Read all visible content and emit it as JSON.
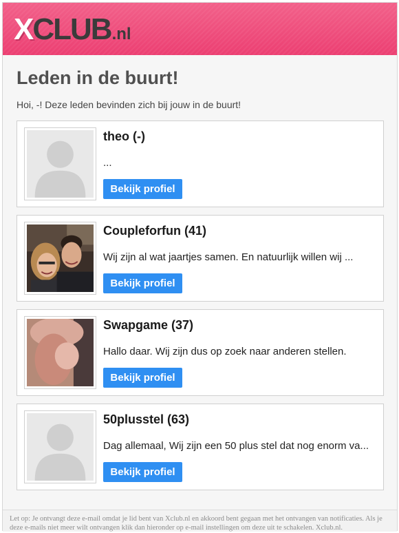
{
  "header": {
    "logo_x": "X",
    "logo_club": "CLUB",
    "logo_tld": ".nl",
    "colors": {
      "brand": "#ee4a79",
      "logo_dark": "#3b3b3b"
    }
  },
  "page": {
    "title": "Leden in de buurt!",
    "intro": "Hoi, -! Deze leden bevinden zich bij jouw in de buurt!"
  },
  "members": [
    {
      "name": "theo (-)",
      "text": "...",
      "photo": "placeholder-avatar",
      "button": "Bekijk profiel"
    },
    {
      "name": "Coupleforfun (41)",
      "text": "Wij zijn al wat jaartjes samen. En natuurlijk willen wij ...",
      "photo": "couple-photo",
      "button": "Bekijk profiel"
    },
    {
      "name": "Swapgame (37)",
      "text": "Hallo daar. Wij zijn dus op zoek naar anderen stellen.",
      "photo": "explicit-photo",
      "button": "Bekijk profiel"
    },
    {
      "name": "50plusstel (63)",
      "text": "Dag allemaal, Wij zijn een 50 plus stel dat nog enorm va...",
      "photo": "placeholder-avatar",
      "button": "Bekijk profiel"
    }
  ],
  "footer": {
    "text": "Let op: Je ontvangt deze e-mail omdat je lid bent van Xclub.nl en akkoord bent gegaan met het ontvangen van notificaties. Als je deze e-mails niet meer wilt ontvangen klik dan hieronder op e-mail instellingen om deze uit te schakelen. Xclub.nl."
  }
}
